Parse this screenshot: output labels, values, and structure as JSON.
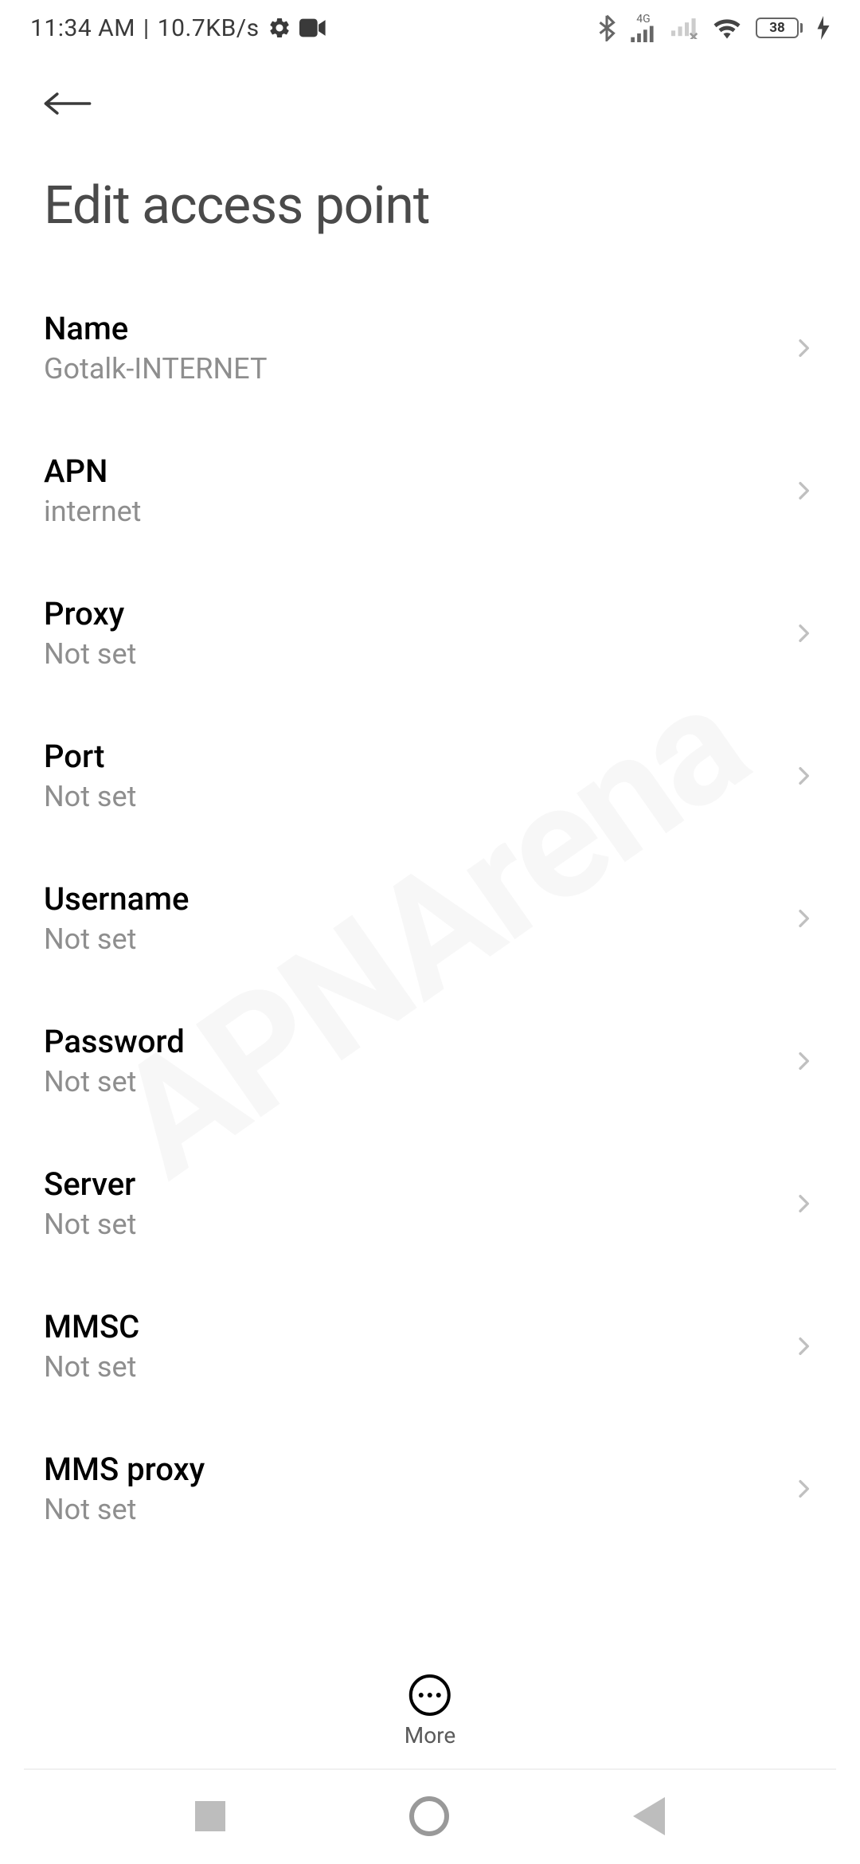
{
  "status_bar": {
    "time": "11:34 AM",
    "separator": "|",
    "data_rate": "10.7KB/s",
    "battery_pct": "38",
    "network_type": "4G"
  },
  "header": {
    "title": "Edit access point"
  },
  "settings": [
    {
      "label": "Name",
      "value": "Gotalk-INTERNET"
    },
    {
      "label": "APN",
      "value": "internet"
    },
    {
      "label": "Proxy",
      "value": "Not set"
    },
    {
      "label": "Port",
      "value": "Not set"
    },
    {
      "label": "Username",
      "value": "Not set"
    },
    {
      "label": "Password",
      "value": "Not set"
    },
    {
      "label": "Server",
      "value": "Not set"
    },
    {
      "label": "MMSC",
      "value": "Not set"
    },
    {
      "label": "MMS proxy",
      "value": "Not set"
    }
  ],
  "bottom_bar": {
    "more_label": "More"
  },
  "watermark": "APNArena"
}
